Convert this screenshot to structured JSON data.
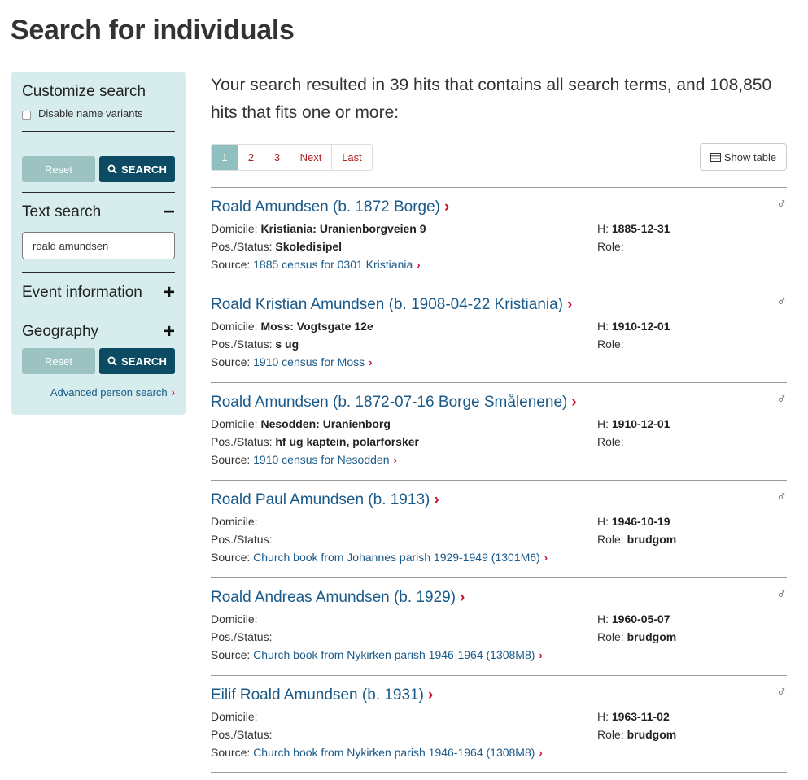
{
  "page_title": "Search for individuals",
  "sidebar": {
    "customize_heading": "Customize search",
    "disable_variants_label": "Disable name variants",
    "reset_label": "Reset",
    "search_label": "SEARCH",
    "text_search_heading": "Text search",
    "text_search_toggle": "−",
    "text_search_value": "roald amundsen",
    "event_heading": "Event information",
    "event_toggle": "+",
    "geography_heading": "Geography",
    "geography_toggle": "+",
    "advanced_link": "Advanced person search"
  },
  "summary_text": "Your search resulted in 39 hits that contains all search terms, and 108,850 hits that fits one or more:",
  "pagination": [
    "1",
    "2",
    "3",
    "Next",
    "Last"
  ],
  "show_table_label": "Show table",
  "labels": {
    "domicile": "Domicile:",
    "pos_status": "Pos./Status:",
    "source": "Source:",
    "h": "H:",
    "role": "Role:"
  },
  "results": [
    {
      "name": "Roald Amundsen (b. 1872 Borge)",
      "gender": "♂",
      "domicile": "Kristiania: Uranienborgveien 9",
      "status": "Skoledisipel",
      "source": "1885 census for 0301 Kristiania",
      "h": "1885-12-31",
      "role": ""
    },
    {
      "name": "Roald Kristian Amundsen (b. 1908-04-22 Kristiania)",
      "gender": "♂",
      "domicile": "Moss: Vogtsgate 12e",
      "status": "s ug",
      "source": "1910 census for Moss",
      "h": "1910-12-01",
      "role": ""
    },
    {
      "name": "Roald Amundsen (b. 1872-07-16 Borge Smålenene)",
      "gender": "♂",
      "domicile": "Nesodden: Uranienborg",
      "status": "hf ug kaptein, polarforsker",
      "source": "1910 census for Nesodden",
      "h": "1910-12-01",
      "role": ""
    },
    {
      "name": "Roald Paul Amundsen (b. 1913)",
      "gender": "♂",
      "domicile": "",
      "status": "",
      "source": "Church book from Johannes parish 1929-1949 (1301M6)",
      "h": "1946-10-19",
      "role": "brudgom"
    },
    {
      "name": "Roald Andreas Amundsen (b. 1929)",
      "gender": "♂",
      "domicile": "",
      "status": "",
      "source": "Church book from Nykirken parish 1946-1964 (1308M8)",
      "h": "1960-05-07",
      "role": "brudgom"
    },
    {
      "name": "Eilif Roald Amundsen (b. 1931)",
      "gender": "♂",
      "domicile": "",
      "status": "",
      "source": "Church book from Nykirken parish 1946-1964 (1308M8)",
      "h": "1963-11-02",
      "role": "brudgom"
    }
  ]
}
